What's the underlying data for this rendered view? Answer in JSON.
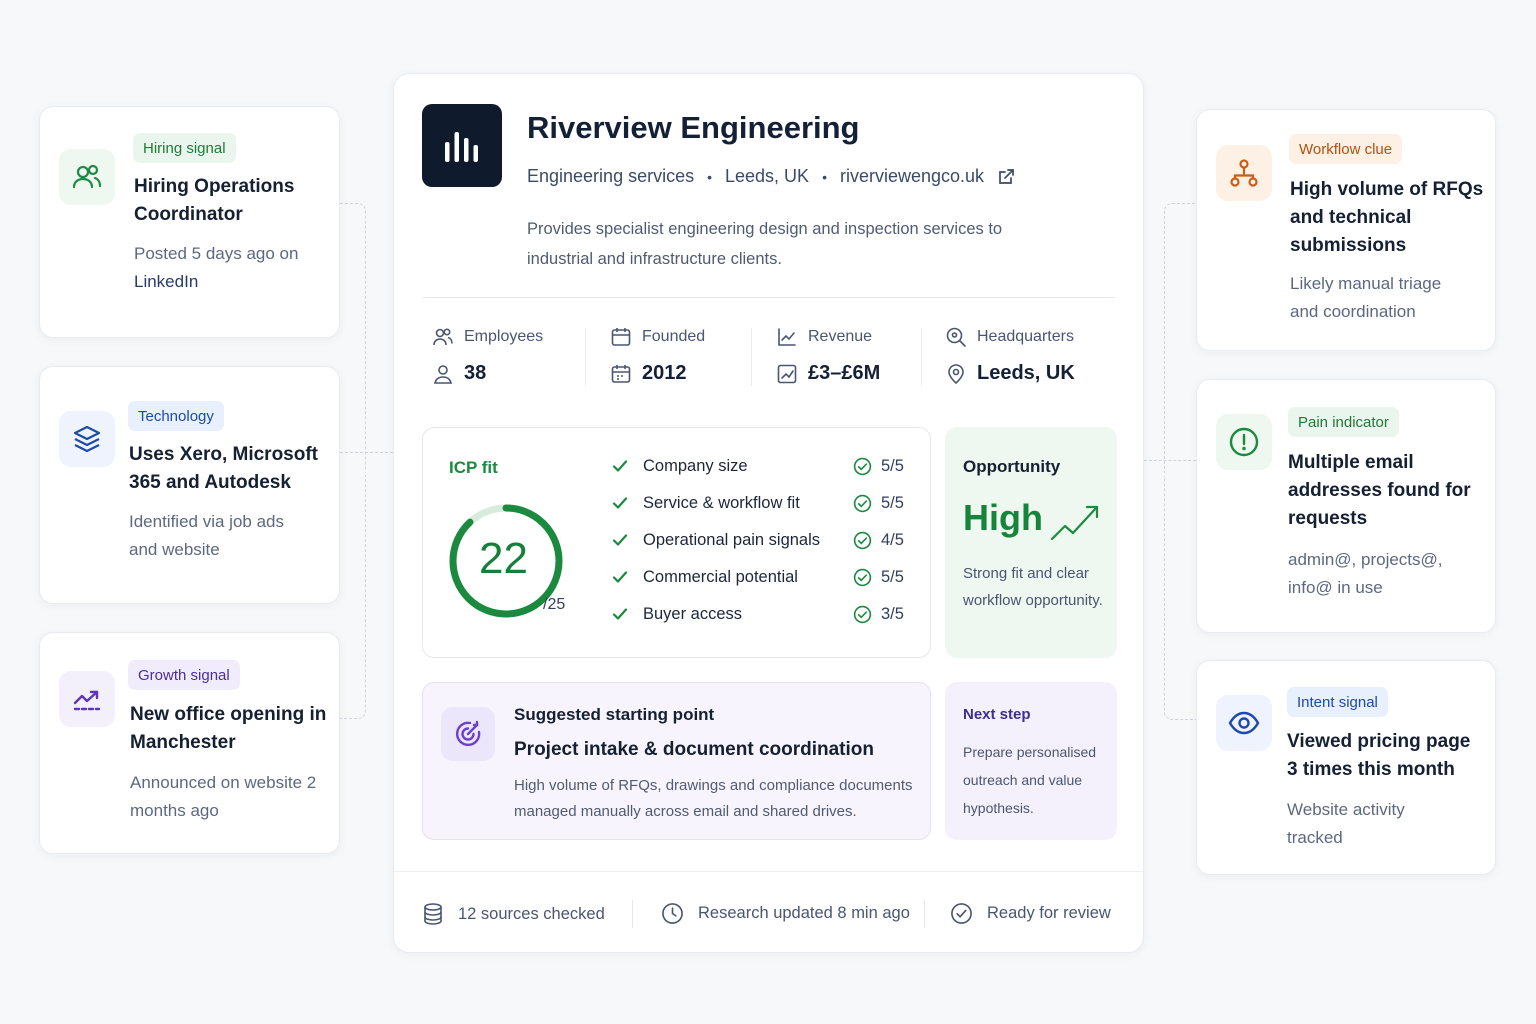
{
  "left_signals": [
    {
      "badge": "Hiring signal",
      "title": "Hiring Operations Coordinator",
      "sub_prefix": "Posted 5 days ago on",
      "sub_highlight": "LinkedIn",
      "icon": "users-icon",
      "badge_bg": "#eaf6ed",
      "badge_fg": "#1f7a3a"
    },
    {
      "badge": "Technology",
      "title": "Uses Xero, Microsoft 365 and Autodesk",
      "sub": "Identified via job ads and website",
      "icon": "layers-icon",
      "badge_bg": "#e8f0fd",
      "badge_fg": "#1e4aa8"
    },
    {
      "badge": "Growth signal",
      "title": "New office opening in Manchester",
      "sub": "Announced on website 2 months ago",
      "icon": "trending-up-icon",
      "badge_bg": "#f1ecfb",
      "badge_fg": "#4b2d9e"
    }
  ],
  "right_signals": [
    {
      "badge": "Workflow clue",
      "title": "High volume of RFQs and technical submissions",
      "sub": "Likely manual triage and coordination",
      "icon": "workflow-icon",
      "badge_bg": "#fdf0e4",
      "badge_fg": "#b4500f"
    },
    {
      "badge": "Pain indicator",
      "title": "Multiple email addresses found for requests",
      "sub": "admin@, projects@, info@ in use",
      "icon": "alert-circle-icon",
      "badge_bg": "#eaf6ed",
      "badge_fg": "#1f7a3a"
    },
    {
      "badge": "Intent signal",
      "title": "Viewed pricing page 3 times this month",
      "sub": "Website activity tracked",
      "icon": "eye-icon",
      "badge_bg": "#e8f0fd",
      "badge_fg": "#1e4aa8"
    }
  ],
  "company": {
    "name": "Riverview Engineering",
    "industry": "Engineering services",
    "location": "Leeds, UK",
    "website": "riverviewengco.uk",
    "description": "Provides specialist engineering design and inspection services to industrial and infrastructure clients."
  },
  "stats": {
    "employees_label": "Employees",
    "employees_value": "38",
    "founded_label": "Founded",
    "founded_value": "2012",
    "revenue_label": "Revenue",
    "revenue_value": "£3–£6M",
    "hq_label": "Headquarters",
    "hq_value": "Leeds, UK"
  },
  "icp": {
    "label": "ICP fit",
    "score": "22",
    "max": "/25",
    "score_fraction": 0.88,
    "criteria": [
      {
        "name": "Company size",
        "score": "5/5"
      },
      {
        "name": "Service & workflow fit",
        "score": "5/5"
      },
      {
        "name": "Operational pain signals",
        "score": "4/5"
      },
      {
        "name": "Commercial potential",
        "score": "5/5"
      },
      {
        "name": "Buyer access",
        "score": "3/5"
      }
    ]
  },
  "opportunity": {
    "title": "Opportunity",
    "value": "High",
    "desc": "Strong fit and clear workflow opportunity."
  },
  "starting_point": {
    "kicker": "Suggested starting point",
    "title": "Project intake & document coordination",
    "desc": "High volume of RFQs, drawings and compliance documents managed manually across email and shared drives."
  },
  "next_step": {
    "title": "Next step",
    "desc": "Prepare personalised outreach and value hypothesis."
  },
  "footer": {
    "sources": "12 sources checked",
    "updated": "Research updated 8 min ago",
    "status": "Ready for review"
  },
  "colors": {
    "green": "#1b8a3e",
    "navy": "#0f1b2d",
    "purple": "#6d3fd1",
    "orange": "#c95d14",
    "blue": "#1e4aa8"
  }
}
